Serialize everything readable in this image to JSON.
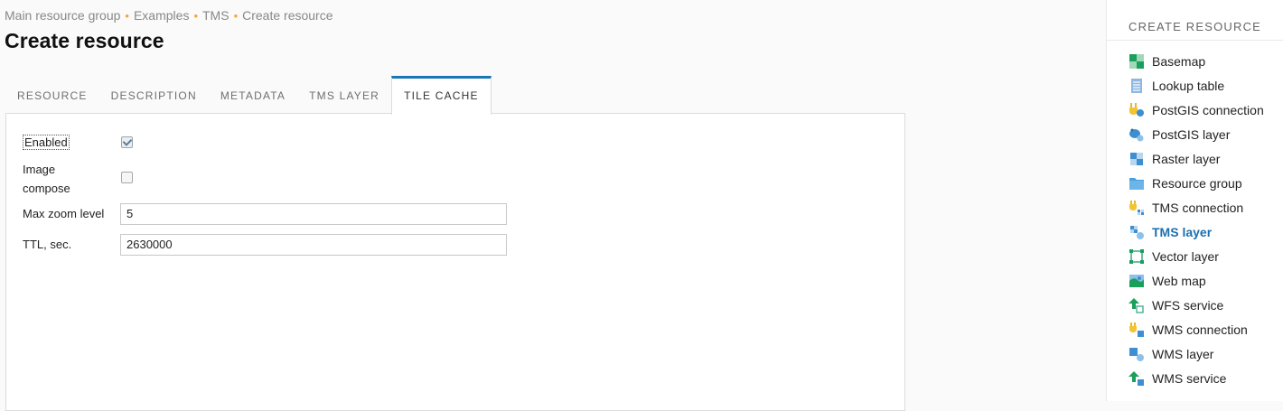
{
  "breadcrumbs": [
    "Main resource group",
    "Examples",
    "TMS",
    "Create resource"
  ],
  "page_title": "Create resource",
  "tabs": [
    {
      "label": "RESOURCE",
      "active": false
    },
    {
      "label": "DESCRIPTION",
      "active": false
    },
    {
      "label": "METADATA",
      "active": false
    },
    {
      "label": "TMS LAYER",
      "active": false
    },
    {
      "label": "TILE CACHE",
      "active": true
    }
  ],
  "form": {
    "enabled_label": "Enabled",
    "enabled_checked": true,
    "image_compose_label": "Image compose",
    "image_compose_checked": false,
    "max_zoom_label": "Max zoom level",
    "max_zoom_value": "5",
    "ttl_label": "TTL, sec.",
    "ttl_value": "2630000"
  },
  "sidebar": {
    "title": "CREATE RESOURCE",
    "items": [
      {
        "label": "Basemap",
        "icon": "basemap-icon"
      },
      {
        "label": "Lookup table",
        "icon": "lookup-table-icon"
      },
      {
        "label": "PostGIS connection",
        "icon": "postgis-connection-icon"
      },
      {
        "label": "PostGIS layer",
        "icon": "postgis-layer-icon"
      },
      {
        "label": "Raster layer",
        "icon": "raster-layer-icon"
      },
      {
        "label": "Resource group",
        "icon": "folder-icon"
      },
      {
        "label": "TMS connection",
        "icon": "tms-connection-icon"
      },
      {
        "label": "TMS layer",
        "icon": "tms-layer-icon",
        "active": true
      },
      {
        "label": "Vector layer",
        "icon": "vector-layer-icon"
      },
      {
        "label": "Web map",
        "icon": "web-map-icon"
      },
      {
        "label": "WFS service",
        "icon": "wfs-service-icon"
      },
      {
        "label": "WMS connection",
        "icon": "wms-connection-icon"
      },
      {
        "label": "WMS layer",
        "icon": "wms-layer-icon"
      },
      {
        "label": "WMS service",
        "icon": "wms-service-icon"
      }
    ]
  },
  "colors": {
    "accent": "#1b76b5",
    "breadcrumb_separator": "#f0a43b",
    "active_sidebar_item": "#1b6fb0"
  }
}
